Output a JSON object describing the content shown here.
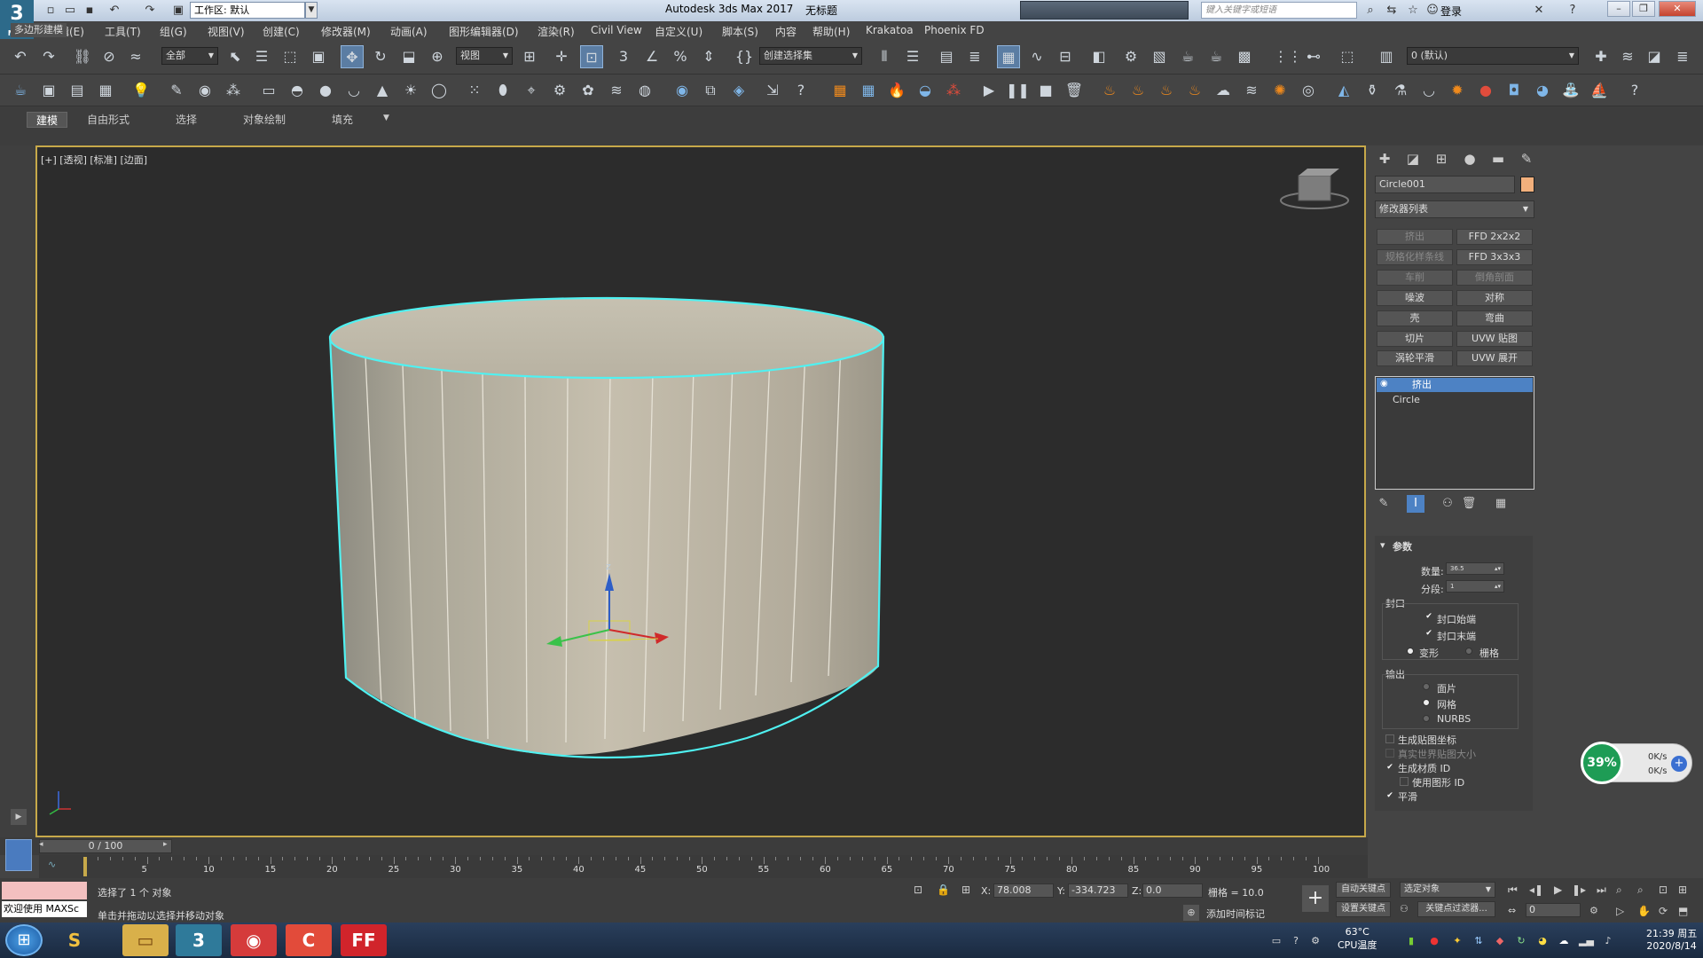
{
  "titlebar": {
    "app_logo": "3",
    "app_logo_sub": "MAX",
    "workspace": "工作区: 默认",
    "window_title": "Autodesk 3ds Max 2017",
    "doc_title": "无标题",
    "search_placeholder": "键入关键字或短语",
    "login": "登录"
  },
  "menu": [
    "编辑(E)",
    "工具(T)",
    "组(G)",
    "视图(V)",
    "创建(C)",
    "修改器(M)",
    "动画(A)",
    "图形编辑器(D)",
    "渲染(R)",
    "Civil View",
    "自定义(U)",
    "脚本(S)",
    "内容",
    "帮助(H)",
    "Krakatoa",
    "Phoenix FD"
  ],
  "toolbar": {
    "filter_select": "全部",
    "view_select": "视图",
    "selection_set": "创建选择集",
    "layer_select": "0 (默认)"
  },
  "ribbon": {
    "tabs": [
      "建模",
      "自由形式",
      "选择",
      "对象绘制",
      "填充"
    ],
    "panel_label": "多边形建模"
  },
  "viewport": {
    "label": "[+] [透视] [标准] [边面]",
    "gizmo_z": "z"
  },
  "command_panel": {
    "object_name": "Circle001",
    "object_color": "#f2b07c",
    "modifier_list": "修改器列表",
    "modifier_buttons": [
      {
        "label": "挤出",
        "dim": true
      },
      {
        "label": "FFD 2x2x2",
        "dim": false
      },
      {
        "label": "规格化样条线",
        "dim": true
      },
      {
        "label": "FFD 3x3x3",
        "dim": false
      },
      {
        "label": "车削",
        "dim": true
      },
      {
        "label": "倒角剖面",
        "dim": true
      },
      {
        "label": "噪波",
        "dim": false
      },
      {
        "label": "对称",
        "dim": false
      },
      {
        "label": "壳",
        "dim": false
      },
      {
        "label": "弯曲",
        "dim": false
      },
      {
        "label": "切片",
        "dim": false
      },
      {
        "label": "UVW 贴图",
        "dim": false
      },
      {
        "label": "涡轮平滑",
        "dim": false
      },
      {
        "label": "UVW 展开",
        "dim": false
      }
    ],
    "stack": {
      "active": "挤出",
      "base": "Circle"
    },
    "params": {
      "rollout_title": "参数",
      "amount_label": "数量:",
      "amount_value": "36.5",
      "segments_label": "分段:",
      "segments_value": "1",
      "capping_title": "封口",
      "cap_start": "封口始端",
      "cap_end": "封口末端",
      "morph": "变形",
      "grid": "栅格",
      "output_title": "输出",
      "patch": "面片",
      "mesh": "网格",
      "nurbs": "NURBS",
      "gen_map_coords": "生成贴图坐标",
      "real_world": "真实世界贴图大小",
      "gen_mat_ids": "生成材质 ID",
      "use_shape_ids": "使用图形 ID",
      "smooth": "平滑"
    }
  },
  "net_widget": {
    "percent": "39%",
    "up": "0K/s",
    "down": "0K/s"
  },
  "timeline": {
    "slider": "0 / 100",
    "ticks": [
      "5",
      "10",
      "15",
      "20",
      "25",
      "30",
      "35",
      "40",
      "45",
      "50",
      "55",
      "60",
      "65",
      "70",
      "75",
      "80",
      "85",
      "90",
      "95",
      "100"
    ]
  },
  "status": {
    "maxscript_label": "欢迎使用 MAXSc",
    "selected": "选择了 1 个 对象",
    "prompt": "单击并拖动以选择并移动对象",
    "x_label": "X:",
    "x_value": "78.008",
    "y_label": "Y:",
    "y_value": "-334.723",
    "z_label": "Z:",
    "z_value": "0.0",
    "grid": "栅格 = 10.0",
    "add_time_tag": "添加时间标记",
    "auto_key": "自动关键点",
    "set_key": "设置关键点",
    "selected_objects": "选定对象",
    "key_filters": "关键点过滤器...",
    "frame": "0"
  },
  "taskbar": {
    "temp": "63°C",
    "temp_label": "CPU温度",
    "time": "21:39 周五",
    "date": "2020/8/14"
  }
}
